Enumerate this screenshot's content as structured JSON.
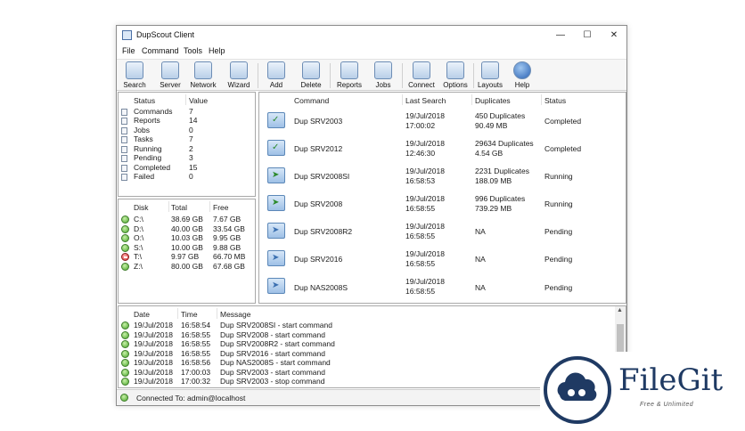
{
  "window": {
    "title": "DupScout Client"
  },
  "menu": [
    "File",
    "Command",
    "Tools",
    "Help"
  ],
  "toolbar": [
    "Search",
    "Server",
    "Network",
    "Wizard",
    "Add",
    "Delete",
    "Reports",
    "Jobs",
    "Connect",
    "Options",
    "Layouts",
    "Help"
  ],
  "stats": {
    "headers": [
      "Status",
      "Value"
    ],
    "rows": [
      {
        "label": "Commands",
        "value": "7"
      },
      {
        "label": "Reports",
        "value": "14"
      },
      {
        "label": "Jobs",
        "value": "0"
      },
      {
        "label": "Tasks",
        "value": "7"
      },
      {
        "label": "Running",
        "value": "2"
      },
      {
        "label": "Pending",
        "value": "3"
      },
      {
        "label": "Completed",
        "value": "15"
      },
      {
        "label": "Failed",
        "value": "0"
      }
    ]
  },
  "disks": {
    "headers": [
      "Disk",
      "Total",
      "Free"
    ],
    "rows": [
      {
        "disk": "C:\\",
        "total": "38.69 GB",
        "free": "7.67 GB",
        "status": "ok"
      },
      {
        "disk": "D:\\",
        "total": "40.00 GB",
        "free": "33.54 GB",
        "status": "ok"
      },
      {
        "disk": "O:\\",
        "total": "10.03 GB",
        "free": "9.95 GB",
        "status": "ok"
      },
      {
        "disk": "S:\\",
        "total": "10.00 GB",
        "free": "9.88 GB",
        "status": "ok"
      },
      {
        "disk": "T:\\",
        "total": "9.97 GB",
        "free": "66.70 MB",
        "status": "error"
      },
      {
        "disk": "Z:\\",
        "total": "80.00 GB",
        "free": "67.68 GB",
        "status": "ok"
      }
    ]
  },
  "commands": {
    "headers": [
      "Command",
      "Last Search",
      "Duplicates",
      "Status"
    ],
    "rows": [
      {
        "name": "Dup SRV2003",
        "date": "19/Jul/2018",
        "time": "17:00:02",
        "dup1": "450 Duplicates",
        "dup2": "90.49 MB",
        "status": "Completed",
        "state": "done"
      },
      {
        "name": "Dup SRV2012",
        "date": "19/Jul/2018",
        "time": "12:46:30",
        "dup1": "29634 Duplicates",
        "dup2": "4.54 GB",
        "status": "Completed",
        "state": "done"
      },
      {
        "name": "Dup SRV2008SI",
        "date": "19/Jul/2018",
        "time": "16:58:53",
        "dup1": "2231 Duplicates",
        "dup2": "188.09 MB",
        "status": "Running",
        "state": "run"
      },
      {
        "name": "Dup SRV2008",
        "date": "19/Jul/2018",
        "time": "16:58:55",
        "dup1": "996 Duplicates",
        "dup2": "739.29 MB",
        "status": "Running",
        "state": "run"
      },
      {
        "name": "Dup SRV2008R2",
        "date": "19/Jul/2018",
        "time": "16:58:55",
        "dup1": "NA",
        "dup2": "",
        "status": "Pending",
        "state": "pend"
      },
      {
        "name": "Dup SRV2016",
        "date": "19/Jul/2018",
        "time": "16:58:55",
        "dup1": "NA",
        "dup2": "",
        "status": "Pending",
        "state": "pend"
      },
      {
        "name": "Dup NAS2008S",
        "date": "19/Jul/2018",
        "time": "16:58:55",
        "dup1": "NA",
        "dup2": "",
        "status": "Pending",
        "state": "pend"
      }
    ]
  },
  "log": {
    "headers": [
      "Date",
      "Time",
      "Message"
    ],
    "rows": [
      {
        "date": "19/Jul/2018",
        "time": "16:58:54",
        "message": "Dup SRV2008SI - start command"
      },
      {
        "date": "19/Jul/2018",
        "time": "16:58:55",
        "message": "Dup SRV2008 - start command"
      },
      {
        "date": "19/Jul/2018",
        "time": "16:58:55",
        "message": "Dup SRV2008R2 - start command"
      },
      {
        "date": "19/Jul/2018",
        "time": "16:58:55",
        "message": "Dup SRV2016 - start command"
      },
      {
        "date": "19/Jul/2018",
        "time": "16:58:56",
        "message": "Dup NAS2008S - start command"
      },
      {
        "date": "19/Jul/2018",
        "time": "17:00:03",
        "message": "Dup SRV2003 - start command"
      },
      {
        "date": "19/Jul/2018",
        "time": "17:00:32",
        "message": "Dup SRV2003 - stop command"
      }
    ]
  },
  "statusbar": {
    "text": "Connected To: admin@localhost"
  },
  "watermark": {
    "name": "FileGit",
    "tagline": "Free & Unlimited"
  }
}
